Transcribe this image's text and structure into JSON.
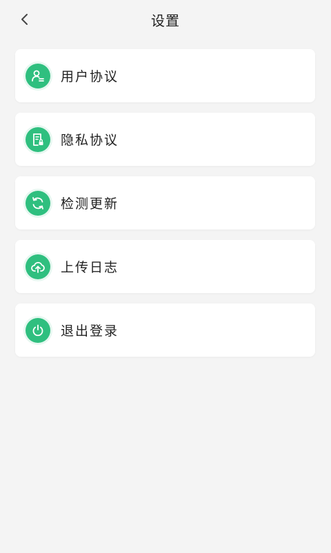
{
  "header": {
    "title": "设置",
    "back_icon": "chevron-left-icon"
  },
  "theme": {
    "accent": "#2fbf7f",
    "background": "#f4f4f4",
    "card": "#ffffff",
    "text": "#222222"
  },
  "menu": {
    "items": [
      {
        "label": "用户协议",
        "icon": "user-icon"
      },
      {
        "label": "隐私协议",
        "icon": "document-lock-icon"
      },
      {
        "label": "检测更新",
        "icon": "refresh-icon"
      },
      {
        "label": "上传日志",
        "icon": "cloud-upload-icon"
      },
      {
        "label": "退出登录",
        "icon": "power-icon"
      }
    ]
  }
}
